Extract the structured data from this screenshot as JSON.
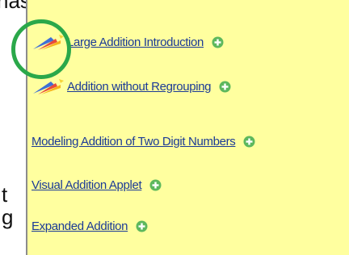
{
  "left_fragments": [
    "has",
    "t",
    "g"
  ],
  "links": [
    {
      "label": "Large Addition Introduction",
      "icon": "pencil-brush-icon"
    },
    {
      "label": "Addition without Regrouping",
      "icon": "pencil-brush-icon"
    },
    {
      "label": "Modeling Addition of Two Digit Numbers",
      "icon": null
    },
    {
      "label": "Visual Addition Applet",
      "icon": null
    },
    {
      "label": "Expanded Addition",
      "icon": null
    }
  ],
  "colors": {
    "panel_background": "#ffff9f",
    "link": "#1b3a96",
    "plus_circle": "#5db85d",
    "highlight_ring": "#2aa84a"
  }
}
